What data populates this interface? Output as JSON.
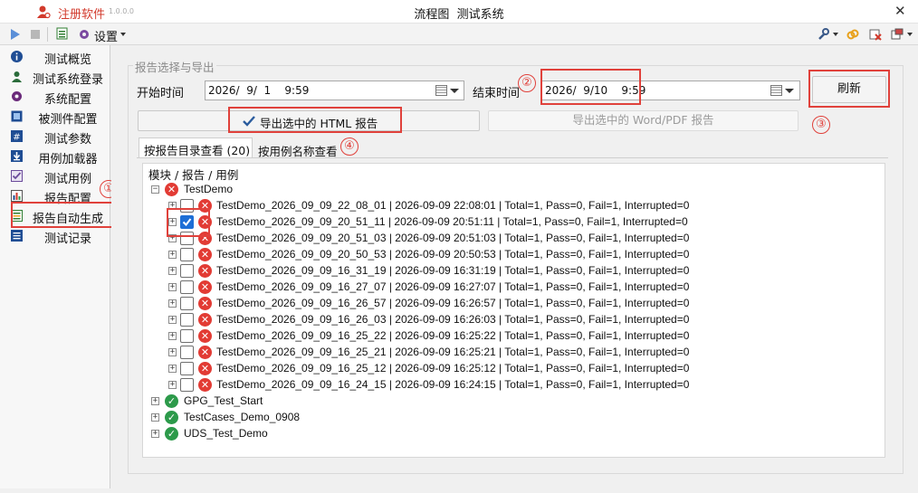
{
  "app": {
    "name": "注册软件",
    "version": "1.0.0.0",
    "title": "流程图  测试系统",
    "close_glyph": "✕"
  },
  "toolbar": {
    "settings_label": "设置"
  },
  "sidebar": {
    "items": [
      {
        "label": "测试概览",
        "icon": "info-icon"
      },
      {
        "label": "测试系统登录",
        "icon": "user-icon"
      },
      {
        "label": "系统配置",
        "icon": "gear-icon"
      },
      {
        "label": "被测件配置",
        "icon": "device-icon"
      },
      {
        "label": "测试参数",
        "icon": "hash-icon"
      },
      {
        "label": "用例加载器",
        "icon": "download-icon"
      },
      {
        "label": "测试用例",
        "icon": "list-check-icon"
      },
      {
        "label": "报告配置",
        "icon": "report-config-icon"
      },
      {
        "label": "报告自动生成",
        "icon": "report-gen-icon"
      },
      {
        "label": "测试记录",
        "icon": "record-icon"
      }
    ]
  },
  "panel": {
    "title": "报告选择与导出",
    "start_label": "开始时间",
    "start_value": "2026/  9/  1    9:59",
    "end_label": "结束时间",
    "end_value": "2026/  9/10    9:59",
    "refresh_label": "刷新",
    "export_html_label": "导出选中的 HTML 报告",
    "export_word_label": "导出选中的 Word/PDF 报告"
  },
  "tabs": {
    "by_dir": "按报告目录查看 (20)",
    "by_case": "按用例名称查看"
  },
  "tree": {
    "header": "模块 / 报告 / 用例",
    "root": "TestDemo",
    "reports": [
      {
        "text": "TestDemo_2026_09_09_22_08_01 | 2026-09-09 22:08:01 | Total=1, Pass=0, Fail=1, Interrupted=0",
        "checked": false
      },
      {
        "text": "TestDemo_2026_09_09_20_51_11 | 2026-09-09 20:51:11 | Total=1, Pass=0, Fail=1, Interrupted=0",
        "checked": true
      },
      {
        "text": "TestDemo_2026_09_09_20_51_03 | 2026-09-09 20:51:03 | Total=1, Pass=0, Fail=1, Interrupted=0",
        "checked": false
      },
      {
        "text": "TestDemo_2026_09_09_20_50_53 | 2026-09-09 20:50:53 | Total=1, Pass=0, Fail=1, Interrupted=0",
        "checked": false
      },
      {
        "text": "TestDemo_2026_09_09_16_31_19 | 2026-09-09 16:31:19 | Total=1, Pass=0, Fail=1, Interrupted=0",
        "checked": false
      },
      {
        "text": "TestDemo_2026_09_09_16_27_07 | 2026-09-09 16:27:07 | Total=1, Pass=0, Fail=1, Interrupted=0",
        "checked": false
      },
      {
        "text": "TestDemo_2026_09_09_16_26_57 | 2026-09-09 16:26:57 | Total=1, Pass=0, Fail=1, Interrupted=0",
        "checked": false
      },
      {
        "text": "TestDemo_2026_09_09_16_26_03 | 2026-09-09 16:26:03 | Total=1, Pass=0, Fail=1, Interrupted=0",
        "checked": false
      },
      {
        "text": "TestDemo_2026_09_09_16_25_22 | 2026-09-09 16:25:22 | Total=1, Pass=0, Fail=1, Interrupted=0",
        "checked": false
      },
      {
        "text": "TestDemo_2026_09_09_16_25_21 | 2026-09-09 16:25:21 | Total=1, Pass=0, Fail=1, Interrupted=0",
        "checked": false
      },
      {
        "text": "TestDemo_2026_09_09_16_25_12 | 2026-09-09 16:25:12 | Total=1, Pass=0, Fail=1, Interrupted=0",
        "checked": false
      },
      {
        "text": "TestDemo_2026_09_09_16_24_15 | 2026-09-09 16:24:15 | Total=1, Pass=0, Fail=1, Interrupted=0",
        "checked": false
      }
    ],
    "modules": [
      {
        "name": "GPG_Test_Start",
        "status": "pass"
      },
      {
        "name": "TestCases_Demo_0908",
        "status": "pass"
      },
      {
        "name": "UDS_Test_Demo",
        "status": "pass"
      }
    ]
  },
  "annotations": [
    "①",
    "②",
    "③",
    "④"
  ],
  "colors": {
    "accent_red": "#e0413b",
    "fail": "#e23b34",
    "pass": "#2c9a4a",
    "check": "#1e6fd6"
  }
}
